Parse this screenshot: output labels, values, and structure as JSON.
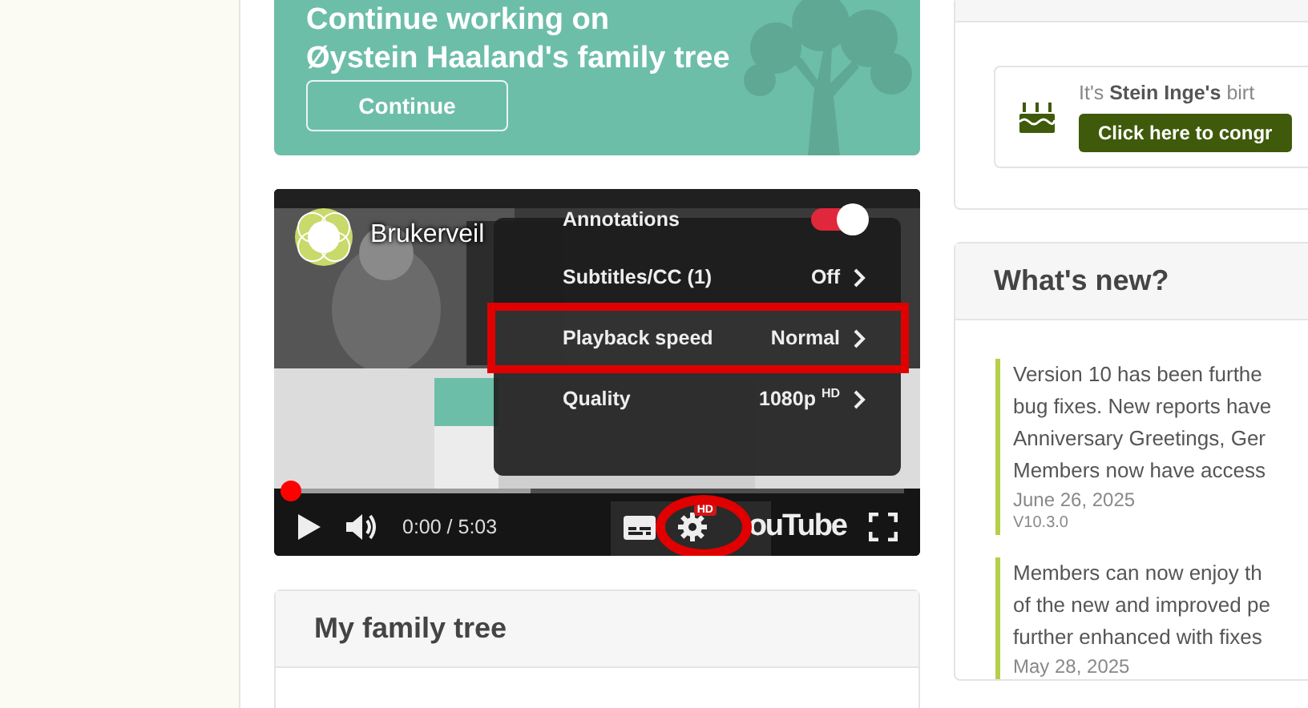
{
  "welcome_card": {
    "heading_lines": [
      "Continue working on",
      "Øystein Haaland's family tree"
    ],
    "button": "Continue"
  },
  "video": {
    "title": "Brukerveil",
    "time": "0:00 / 5:03",
    "level": 0,
    "logo_text": "ouTube",
    "hd_badge": "HD",
    "settings_circled": true,
    "menu": [
      {
        "kind": "toggle",
        "label": "Annotations",
        "on": true,
        "highlighted": false
      },
      {
        "kind": "submenu",
        "label": "Subtitles/CC (1)",
        "value": "Off",
        "highlighted": false
      },
      {
        "kind": "submenu",
        "label": "Playback speed",
        "value": "Normal",
        "highlighted": true
      },
      {
        "kind": "submenu",
        "label": "Quality",
        "value": "1080p $^{HD}$",
        "highlighted": false
      }
    ]
  },
  "family_tree_card": {
    "title": "My family tree"
  },
  "birthday": {
    "text": "It's **Stein Inge's** birt",
    "button": "Click here to congr"
  },
  "whats_new": {
    "title": "What's new?",
    "entries": [
      {
        "lines": [
          "Version 10 has been furthe",
          "bug fixes. New reports have",
          "Anniversary Greetings, Ger",
          "Members now have access"
        ],
        "date": "June 26, 2025",
        "version": "V10.3.0"
      },
      {
        "lines": [
          "Members can now enjoy th",
          "of the new and improved pe",
          "further enhanced with fixes"
        ],
        "date": "May 28, 2025"
      }
    ]
  }
}
